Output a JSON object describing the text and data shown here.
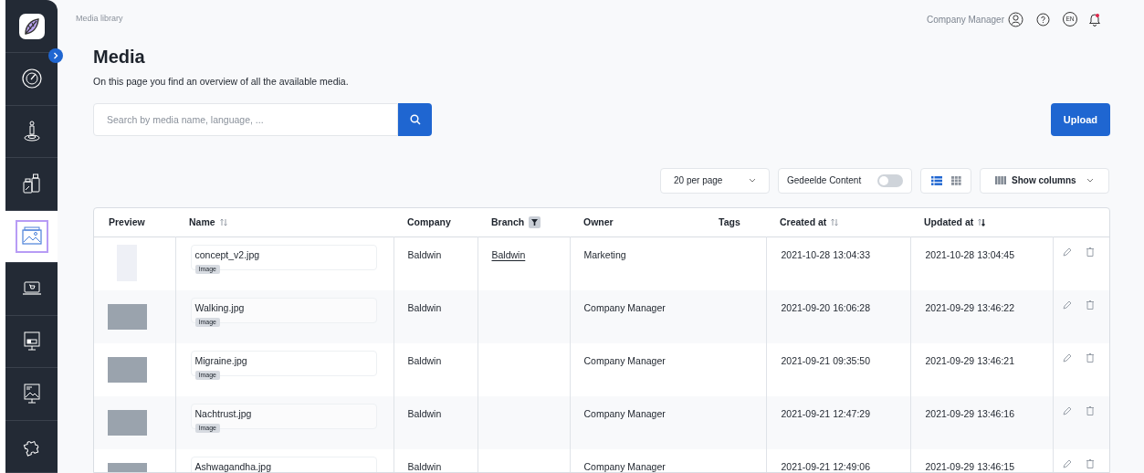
{
  "sidebar": {
    "items": [
      {
        "selected": false
      },
      {
        "selected": false
      },
      {
        "selected": false
      },
      {
        "selected": true
      },
      {
        "selected": false
      },
      {
        "selected": false
      },
      {
        "selected": false
      },
      {
        "selected": false
      }
    ]
  },
  "breadcrumb": "Media library",
  "user": {
    "name": "Company Manager",
    "language": "EN"
  },
  "page": {
    "title": "Media",
    "description": "On this page you find an overview of all the available media."
  },
  "search": {
    "placeholder": "Search by media name, language, ..."
  },
  "upload_button": "Upload",
  "toolbar": {
    "per_page": "20 per page",
    "shared_content": {
      "label": "Gedeelde Content",
      "on": false
    },
    "views": [
      {
        "kind": "list",
        "selected": true
      },
      {
        "kind": "grid",
        "selected": false
      }
    ],
    "show_columns": "Show columns"
  },
  "table": {
    "columns": [
      {
        "label": "Preview",
        "sortable": false,
        "filter": false
      },
      {
        "label": "Name",
        "sortable": true,
        "sorted_desc": false,
        "filter": false
      },
      {
        "label": "Company",
        "sortable": false,
        "filter": false
      },
      {
        "label": "Branch",
        "sortable": false,
        "filter": true
      },
      {
        "label": "Owner",
        "sortable": false,
        "filter": false
      },
      {
        "label": "Tags",
        "sortable": false,
        "filter": false
      },
      {
        "label": "Created at",
        "sortable": true,
        "sorted_desc": false,
        "filter": false
      },
      {
        "label": "Updated at",
        "sortable": true,
        "sorted_desc": true,
        "filter": false
      }
    ],
    "rows": [
      {
        "kind": "sketch",
        "name": "concept_v2.jpg",
        "type": "Image",
        "company": "Baldwin",
        "branch": "Baldwin",
        "owner": "Marketing",
        "created": "2021-10-28 13:04:33",
        "updated": "2021-10-28 13:04:45"
      },
      {
        "kind": "photo",
        "name": "Walking.jpg",
        "type": "Image",
        "company": "Baldwin",
        "owner": "Company Manager",
        "created": "2021-09-20 16:06:28",
        "updated": "2021-09-29 13:46:22"
      },
      {
        "kind": "photo",
        "name": "Migraine.jpg",
        "type": "Image",
        "company": "Baldwin",
        "owner": "Company Manager",
        "created": "2021-09-21 09:35:50",
        "updated": "2021-09-29 13:46:21"
      },
      {
        "kind": "photo",
        "name": "Nachtrust.jpg",
        "type": "Image",
        "company": "Baldwin",
        "owner": "Company Manager",
        "created": "2021-09-21 12:47:29",
        "updated": "2021-09-29 13:46:16"
      },
      {
        "kind": "photo",
        "name": "Ashwagandha.jpg",
        "company": "Baldwin",
        "owner": "Company Manager",
        "created": "2021-09-21 12:49:06",
        "updated": "2021-09-29 13:46:15"
      }
    ]
  }
}
